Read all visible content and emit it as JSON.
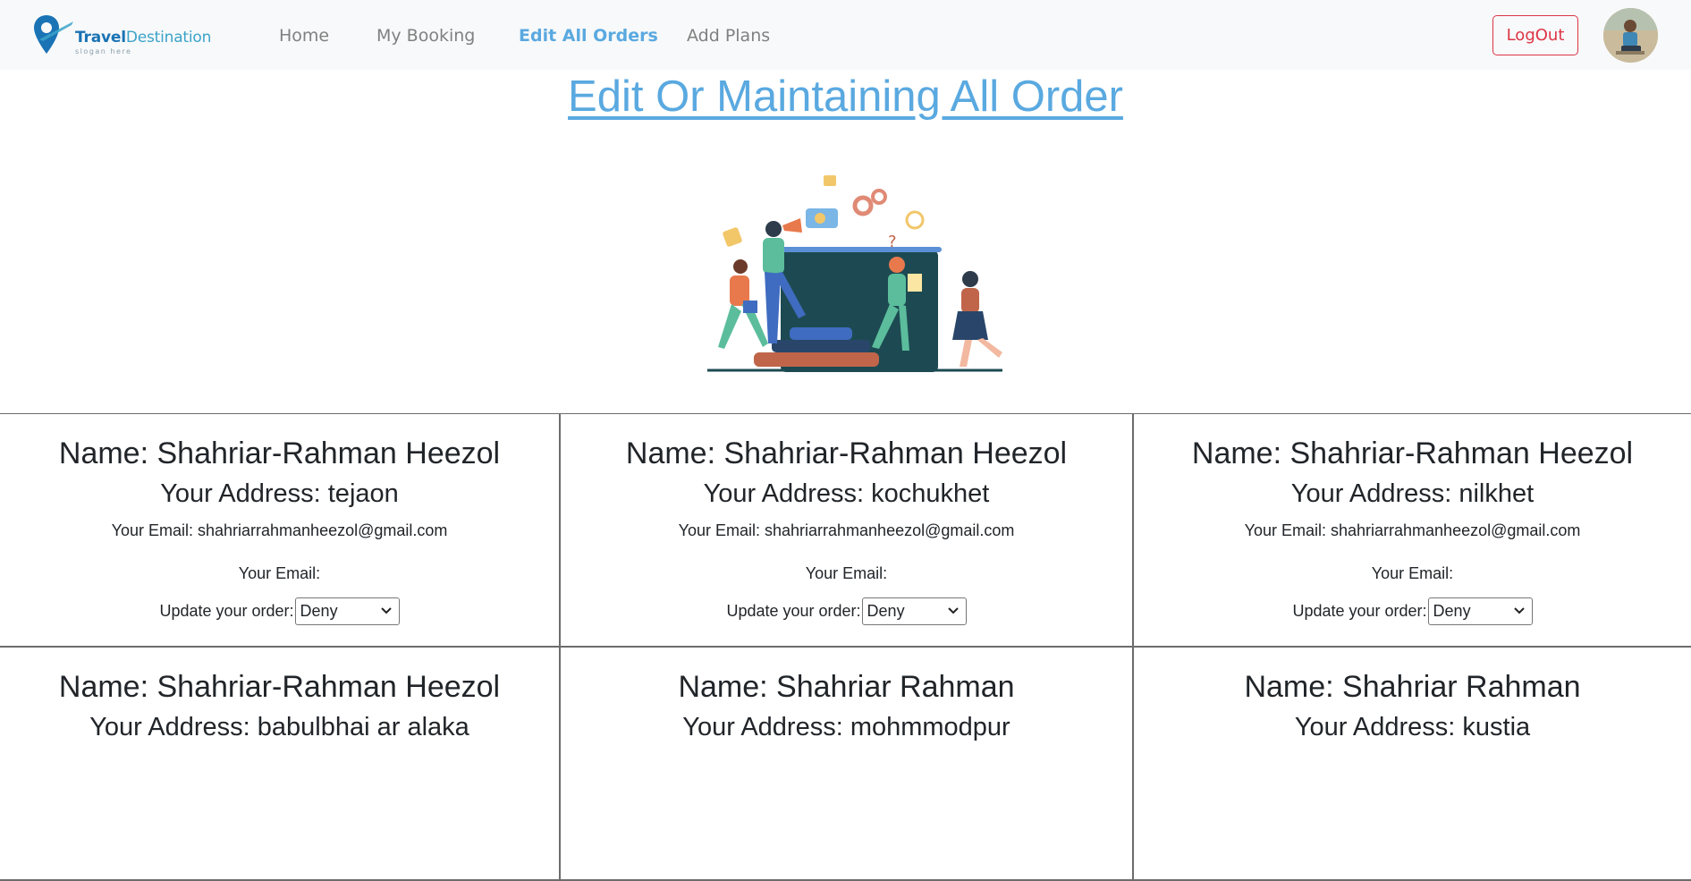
{
  "brand": {
    "name_part1": "Travel",
    "name_part2": "Destination",
    "slogan": "slogan here"
  },
  "nav": {
    "links": [
      {
        "label": "Home",
        "active": false
      },
      {
        "label": "My Booking",
        "active": false
      },
      {
        "label": "Edit All Orders",
        "active": true
      },
      {
        "label": "Add Plans",
        "active": false
      }
    ],
    "logout_label": "LogOut"
  },
  "page": {
    "title": "Edit Or Maintaining All Order"
  },
  "orders": [
    {
      "name": "Name: Shahriar-Rahman Heezol",
      "address": "Your Address: tejaon",
      "email": "Your Email: shahriarrahmanheezol@gmail.com",
      "email2": "Your Email:",
      "update_label": "Update your order:",
      "status": "Deny"
    },
    {
      "name": "Name: Shahriar-Rahman Heezol",
      "address": "Your Address: kochukhet",
      "email": "Your Email: shahriarrahmanheezol@gmail.com",
      "email2": "Your Email:",
      "update_label": "Update your order:",
      "status": "Deny"
    },
    {
      "name": "Name: Shahriar-Rahman Heezol",
      "address": "Your Address: nilkhet",
      "email": "Your Email: shahriarrahmanheezol@gmail.com",
      "email2": "Your Email:",
      "update_label": "Update your order:",
      "status": "Deny"
    },
    {
      "name": "Name: Shahriar-Rahman Heezol",
      "address": "Your Address: babulbhai ar alaka",
      "email": "",
      "email2": "",
      "update_label": "",
      "status": ""
    },
    {
      "name": "Name: Shahriar Rahman",
      "address": "Your Address: mohmmodpur",
      "email": "",
      "email2": "",
      "update_label": "",
      "status": ""
    },
    {
      "name": "Name: Shahriar Rahman",
      "address": "Your Address: kustia",
      "email": "",
      "email2": "",
      "update_label": "",
      "status": ""
    }
  ],
  "colors": {
    "accent": "#5aa9e0",
    "danger": "#dc3545",
    "navbar_bg": "#f8f9fa"
  }
}
